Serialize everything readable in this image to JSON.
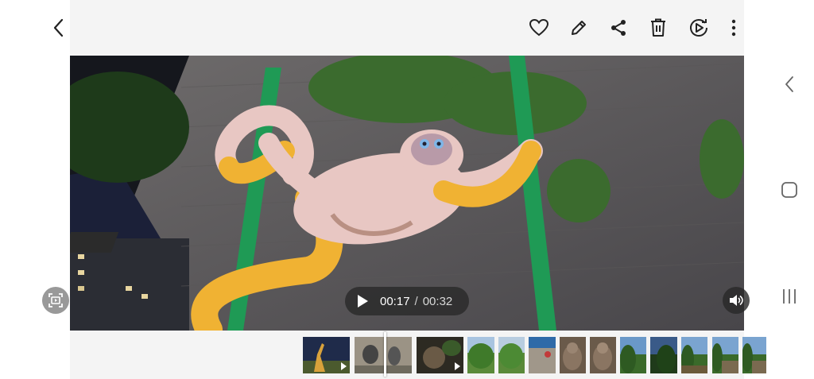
{
  "topbar": {
    "actions": [
      {
        "name": "back-button",
        "icon": "chevron-left-icon"
      },
      {
        "name": "favorite-button",
        "icon": "heart-icon"
      },
      {
        "name": "edit-button",
        "icon": "pencil-icon"
      },
      {
        "name": "share-button",
        "icon": "share-icon"
      },
      {
        "name": "delete-button",
        "icon": "trash-icon"
      },
      {
        "name": "remaster-button",
        "icon": "play-remaster-icon"
      },
      {
        "name": "more-button",
        "icon": "more-vertical-icon"
      }
    ]
  },
  "player": {
    "current_time": "00:17",
    "separator": "/",
    "total_time": "00:32",
    "play_icon": "play-icon",
    "capture_icon": "frame-capture-icon",
    "volume_icon": "speaker-icon"
  },
  "system_nav": {
    "back_icon": "nav-back-icon",
    "home_icon": "nav-home-icon",
    "recents_icon": "nav-recents-icon"
  },
  "filmstrip": {
    "thumbnails": [
      {
        "kind": "video",
        "scene": "giraffe"
      },
      {
        "kind": "video",
        "scene": "monkey-current"
      },
      {
        "kind": "video",
        "scene": "monkey"
      },
      {
        "kind": "photo",
        "scene": "tree"
      },
      {
        "kind": "photo",
        "scene": "tree"
      },
      {
        "kind": "photo",
        "scene": "playground"
      },
      {
        "kind": "photo",
        "scene": "monkey-statue"
      },
      {
        "kind": "photo",
        "scene": "monkey-statue"
      },
      {
        "kind": "photo",
        "scene": "trees-sky"
      },
      {
        "kind": "photo",
        "scene": "trees-sky"
      },
      {
        "kind": "photo",
        "scene": "trees-sky"
      },
      {
        "kind": "photo",
        "scene": "trees-sky"
      },
      {
        "kind": "photo",
        "scene": "trees-sky"
      }
    ]
  },
  "colors": {
    "pole": "#1f9a55",
    "monkey_body": "#e8c7c3",
    "monkey_tail": "#f0b233"
  }
}
